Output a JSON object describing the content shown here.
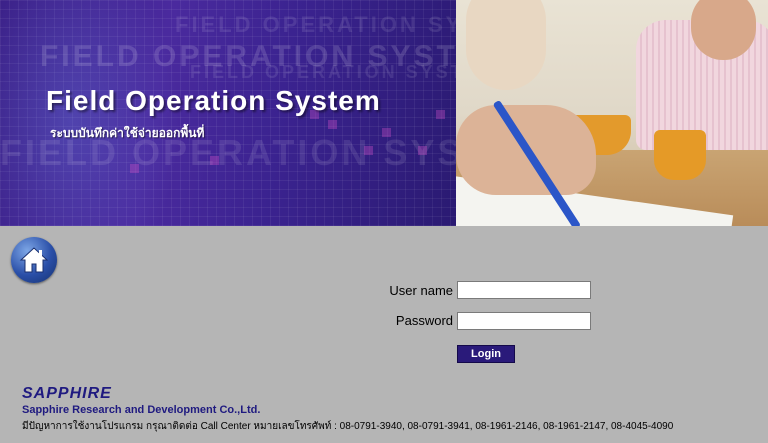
{
  "banner": {
    "title": "Field Operation System",
    "subtitle": "ระบบบันทึกค่าใช้จ่ายออกพื้นที่",
    "ghost_text": "FIELD OPERATION SYSTEM"
  },
  "login": {
    "username_label": "User name",
    "password_label": "Password",
    "username_value": "",
    "password_value": "",
    "login_label": "Login"
  },
  "footer": {
    "logo_text": "SAPPHIRE",
    "company_name": "Sapphire Research and Development Co.,Ltd.",
    "contact_text": "มีปัญหาการใช้งานโปรแกรม กรุณาติดต่อ Call Center หมายเลขโทรศัพท์ : 08-0791-3940, 08-0791-3941, 08-1961-2146, 08-1961-2147, 08-4045-4090"
  },
  "icons": {
    "home": "home-icon"
  },
  "colors": {
    "banner_purple": "#3a1e86",
    "brand_navy": "#1f1a80",
    "page_gray": "#b5b5b5",
    "login_button": "#2a1a7a"
  }
}
